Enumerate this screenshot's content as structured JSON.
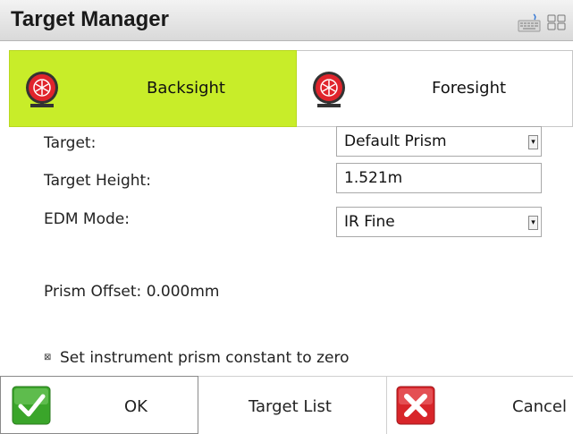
{
  "window": {
    "title": "Target Manager",
    "toolbar_icons": [
      "keyboard-icon",
      "grid-icon"
    ]
  },
  "tabs": [
    {
      "label": "Backsight",
      "icon": "prism-target-icon",
      "active": true
    },
    {
      "label": "Foresight",
      "icon": "prism-target-icon",
      "active": false
    }
  ],
  "form": {
    "target_label": "Target:",
    "target_value": "Default Prism",
    "height_label": "Target Height:",
    "height_value": "1.521m",
    "edm_label": "EDM Mode:",
    "edm_value": "IR Fine",
    "prism_offset": "Prism Offset: 0.000mm",
    "prism_constant_label": "Set instrument prism constant to zero",
    "prism_constant_checked": true
  },
  "buttons": {
    "ok": "OK",
    "target_list": "Target List",
    "cancel": "Cancel"
  },
  "colors": {
    "active_tab": "#c8ed29",
    "ok_green": "#3aa52a",
    "cancel_red": "#d8252a",
    "prism_red": "#e0242c"
  }
}
